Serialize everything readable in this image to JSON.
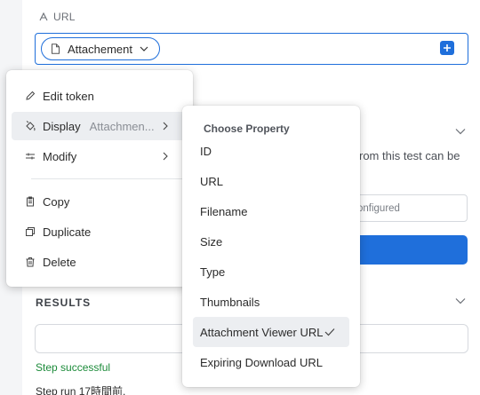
{
  "field": {
    "label": "URL",
    "token_label": "Attachement"
  },
  "background": {
    "description_text": "rom this test can be",
    "input_placeholder": "onfigured",
    "results_label": "RESULTS",
    "step_status": "Step successful",
    "step_run": "Step run 17時間前."
  },
  "menu": {
    "items": [
      {
        "label": "Edit token",
        "icon": "pencil-icon"
      },
      {
        "label": "Display",
        "sublabel": "Attachmen...",
        "icon": "paint-bucket-icon"
      },
      {
        "label": "Modify",
        "icon": "sliders-icon"
      },
      {
        "label": "Copy",
        "icon": "clipboard-icon"
      },
      {
        "label": "Duplicate",
        "icon": "duplicate-icon"
      },
      {
        "label": "Delete",
        "icon": "trash-icon"
      }
    ]
  },
  "submenu": {
    "heading": "Choose Property",
    "items": [
      "ID",
      "URL",
      "Filename",
      "Size",
      "Type",
      "Thumbnails",
      "Attachment Viewer URL",
      "Expiring Download URL"
    ],
    "selected": "Attachment Viewer URL"
  },
  "colors": {
    "accent": "#1f6fdb",
    "success": "#1c8b3a"
  }
}
